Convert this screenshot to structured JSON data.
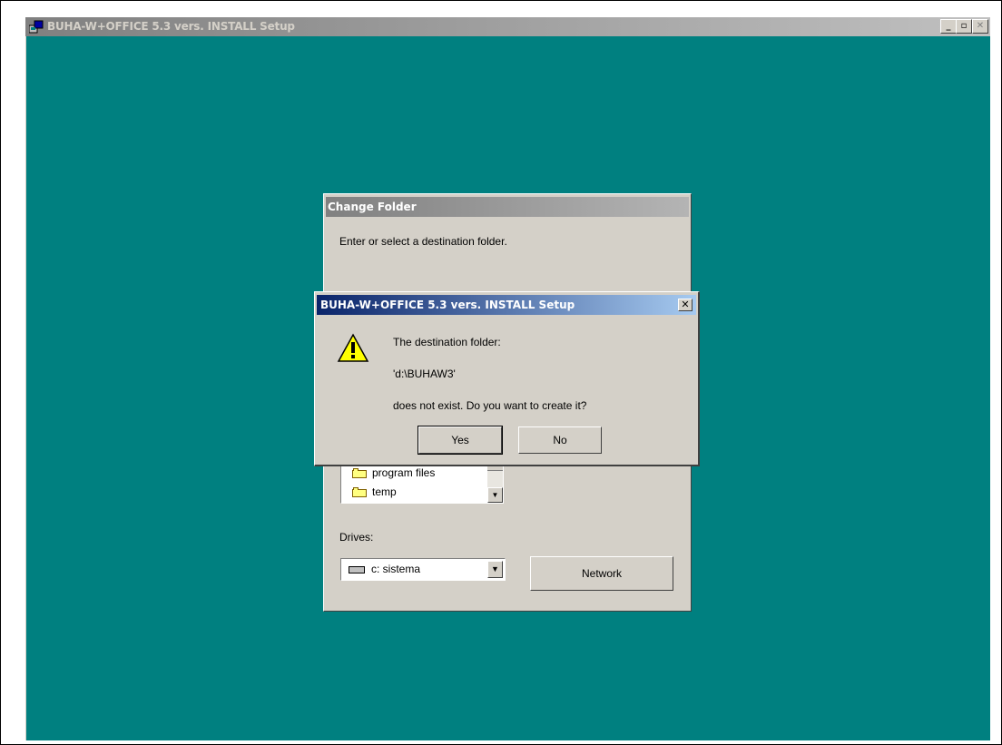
{
  "window": {
    "title": "BUHA-W+OFFICE 5.3 vers. INSTALL Setup",
    "minimize_glyph": "_",
    "maximize_glyph": "▫",
    "close_glyph": "✕"
  },
  "change_folder": {
    "title": "Change Folder",
    "prompt": "Enter or select a destination folder.",
    "folders": [
      "program files",
      "temp"
    ],
    "drives_label": "Drives:",
    "drive_value": "c: sistema",
    "network_label": "Network"
  },
  "message_box": {
    "title": "BUHA-W+OFFICE 5.3 vers. INSTALL Setup",
    "line1": "The destination folder:",
    "line2": "'d:\\BUHAW3'",
    "line3": "does not exist. Do you want to create it?",
    "yes_label": "Yes",
    "no_label": "No",
    "icon": "warning-icon"
  }
}
